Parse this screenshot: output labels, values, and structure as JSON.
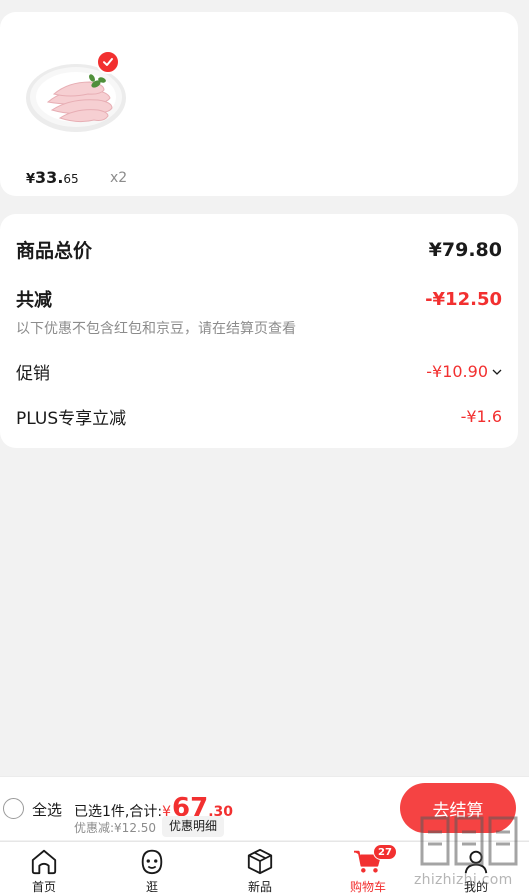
{
  "product": {
    "image": "chicken-feet-photo",
    "selected": true,
    "price_symbol": "¥",
    "price_int": "33.",
    "price_cents": "65",
    "quantity": "x2"
  },
  "summary": {
    "total_label": "商品总价",
    "total_value": "¥79.80",
    "reduce_label": "共减",
    "reduce_value": "-¥12.50",
    "note": "以下优惠不包含红包和京豆，请在结算页查看",
    "promo_label": "促销",
    "promo_value": "-¥10.90",
    "plus_label": "PLUS专享立减",
    "plus_value": "-¥1.6"
  },
  "checkout": {
    "select_all_label": "全选",
    "selected_text": "已选1件,合计:",
    "total_symbol": "¥",
    "total_int": "67",
    "total_dec": ".30",
    "discount_text": "优惠减:¥12.50",
    "discount_detail": "优惠明细",
    "button_label": "去结算"
  },
  "nav": {
    "items": [
      {
        "label": "首页",
        "icon": "home-icon"
      },
      {
        "label": "逛",
        "icon": "face-icon"
      },
      {
        "label": "新品",
        "icon": "box-icon"
      },
      {
        "label": "购物车",
        "icon": "cart-icon",
        "active": true,
        "badge": "27"
      },
      {
        "label": "我的",
        "icon": "user-icon"
      }
    ]
  },
  "watermark": {
    "text": "zhizhizhi.com"
  },
  "colors": {
    "accent": "#f23030",
    "checkout_button": "#f54343",
    "background": "#f2f2f2",
    "muted_text": "#8c8c8c"
  }
}
